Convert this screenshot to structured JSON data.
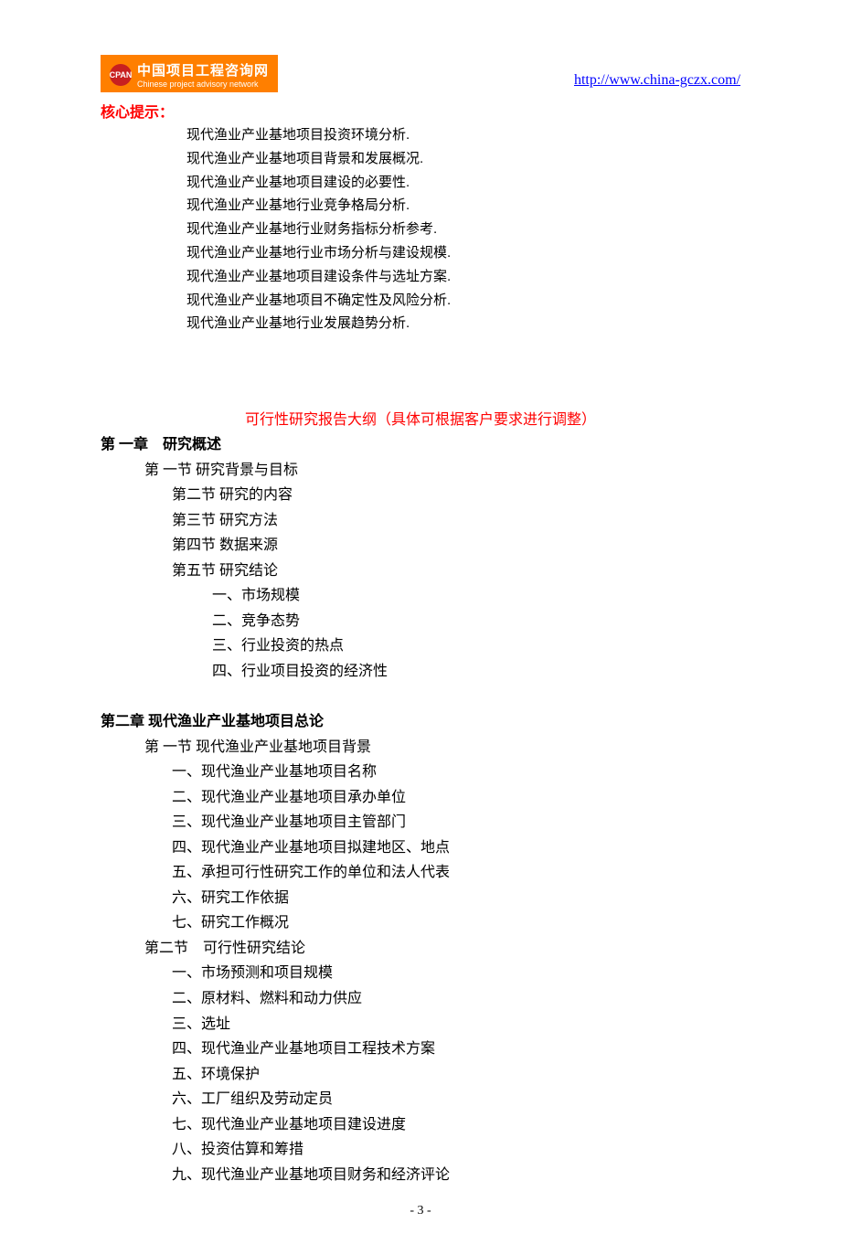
{
  "header": {
    "logo_cn": "中国项目工程咨询网",
    "logo_en": "Chinese project advisory network",
    "logo_badge": "CPAN",
    "url": "http://www.china-gczx.com/"
  },
  "core_hint_label": "核心提示：",
  "hints": [
    "现代渔业产业基地项目投资环境分析.",
    "现代渔业产业基地项目背景和发展概况.",
    "现代渔业产业基地项目建设的必要性.",
    "现代渔业产业基地行业竞争格局分析.",
    "现代渔业产业基地行业财务指标分析参考.",
    "现代渔业产业基地行业市场分析与建设规模.",
    "现代渔业产业基地项目建设条件与选址方案.",
    "现代渔业产业基地项目不确定性及风险分析.",
    "现代渔业产业基地行业发展趋势分析."
  ],
  "outline_title": "可行性研究报告大纲（具体可根据客户要求进行调整）",
  "chapter1": {
    "title": "第 一章　研究概述",
    "s1": "第 一节  研究背景与目标",
    "s2": "第二节  研究的内容",
    "s3": "第三节  研究方法",
    "s4": "第四节  数据来源",
    "s5": "第五节  研究结论",
    "s5_items": [
      "一、市场规模",
      "二、竞争态势",
      "三、行业投资的热点",
      "四、行业项目投资的经济性"
    ]
  },
  "chapter2": {
    "title": "第二章  现代渔业产业基地项目总论",
    "s1": "第 一节  现代渔业产业基地项目背景",
    "s1_items": [
      "一、现代渔业产业基地项目名称",
      "二、现代渔业产业基地项目承办单位",
      "三、现代渔业产业基地项目主管部门",
      "四、现代渔业产业基地项目拟建地区、地点",
      "五、承担可行性研究工作的单位和法人代表",
      "六、研究工作依据",
      "七、研究工作概况"
    ],
    "s2": "第二节　可行性研究结论",
    "s2_items": [
      "一、市场预测和项目规模",
      "二、原材料、燃料和动力供应",
      "三、选址",
      "四、现代渔业产业基地项目工程技术方案",
      "五、环境保护",
      "六、工厂组织及劳动定员",
      "七、现代渔业产业基地项目建设进度",
      "八、投资估算和筹措",
      "九、现代渔业产业基地项目财务和经济评论"
    ]
  },
  "page_number": "- 3 -"
}
